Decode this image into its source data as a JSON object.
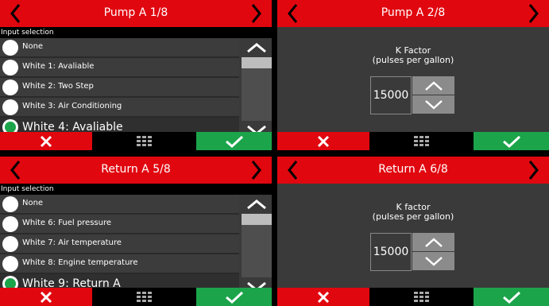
{
  "colors": {
    "header_red": "#e1070f",
    "ok_green": "#1ca44b",
    "panel_dark": "#3a3a3a"
  },
  "panels": [
    {
      "title": "Pump A 1/8",
      "subtitle": "Input selection",
      "options": [
        "None",
        "White 1: Avaliable",
        "White 2: Two Step",
        "White 3: Air Conditioning",
        "White 4: Avaliable"
      ],
      "selected_index": 4
    },
    {
      "title": "Pump A 2/8",
      "k_label": "K Factor",
      "k_sub": "(pulses per gallon)",
      "value": "15000"
    },
    {
      "title": "Return A 5/8",
      "subtitle": "Input selection",
      "options": [
        "None",
        "White 6: Fuel pressure",
        "White 7: Air temperature",
        "White 8: Engine temperature",
        "White 9: Return A"
      ],
      "selected_index": 4
    },
    {
      "title": "Return A 6/8",
      "k_label": "K factor",
      "k_sub": "(pulses per gallon)",
      "value": "15000"
    }
  ],
  "icons": {
    "prev": "chevron-left-icon",
    "next": "chevron-right-icon",
    "up": "chevron-up-icon",
    "down": "chevron-down-icon",
    "cancel": "close-icon",
    "menu": "grid-menu-icon",
    "ok": "check-icon"
  }
}
